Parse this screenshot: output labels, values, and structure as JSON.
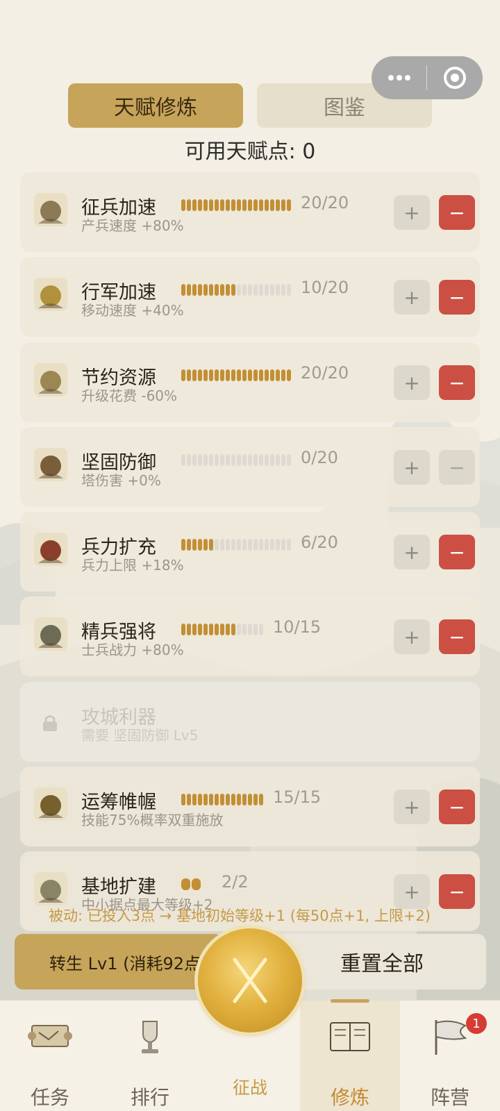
{
  "capsule": {
    "more_icon": "more-dots-icon",
    "close_icon": "target-circle-icon"
  },
  "tabs": [
    {
      "label": "天赋修炼",
      "active": true
    },
    {
      "label": "图鉴",
      "active": false
    }
  ],
  "points_label": "可用天赋点: 0",
  "talents": [
    {
      "name": "征兵加速",
      "desc": "产兵速度 +80%",
      "level": 20,
      "max": 20,
      "count": "20/20",
      "icon": "soldiers-icon",
      "minus_enabled": true
    },
    {
      "name": "行军加速",
      "desc": "移动速度 +40%",
      "level": 10,
      "max": 20,
      "count": "10/20",
      "icon": "march-icon",
      "minus_enabled": true
    },
    {
      "name": "节约资源",
      "desc": "升级花费 -60%",
      "level": 20,
      "max": 20,
      "count": "20/20",
      "icon": "resource-icon",
      "minus_enabled": true
    },
    {
      "name": "坚固防御",
      "desc": "塔伤害 +0%",
      "level": 0,
      "max": 20,
      "count": "0/20",
      "icon": "defense-icon",
      "minus_enabled": false
    },
    {
      "name": "兵力扩充",
      "desc": "兵力上限 +18%",
      "level": 6,
      "max": 20,
      "count": "6/20",
      "icon": "troop-icon",
      "minus_enabled": true
    },
    {
      "name": "精兵强将",
      "desc": "士兵战力 +80%",
      "level": 10,
      "max": 15,
      "count": "10/15",
      "icon": "elite-icon",
      "minus_enabled": true
    },
    {
      "name": "攻城利器",
      "desc": "需要 坚固防御 Lv5",
      "locked": true,
      "icon": "lock-icon"
    },
    {
      "name": "运筹帷幄",
      "desc": "技能75%概率双重施放",
      "level": 15,
      "max": 15,
      "count": "15/15",
      "icon": "strategy-icon",
      "minus_enabled": true
    },
    {
      "name": "基地扩建",
      "desc": "中小据点最大等级+2",
      "level": 2,
      "max": 2,
      "count": "2/2",
      "icon": "base-icon",
      "minus_enabled": true
    }
  ],
  "buttons": {
    "plus": "+",
    "minus": "−"
  },
  "hint": "被动: 已投入3点 → 基地初始等级+1 (每50点+1, 上限+2)",
  "rebirth_label": "转生 Lv1 (消耗92点)",
  "reset_label": "重置全部",
  "nav": [
    {
      "label": "任务",
      "icon": "scroll-map-icon"
    },
    {
      "label": "排行",
      "icon": "trophy-icon"
    },
    {
      "label": "征战",
      "icon": "crossed-swords-icon"
    },
    {
      "label": "修炼",
      "icon": "book-icon",
      "active": true
    },
    {
      "label": "阵营",
      "icon": "flag-icon",
      "badge": "1"
    }
  ]
}
